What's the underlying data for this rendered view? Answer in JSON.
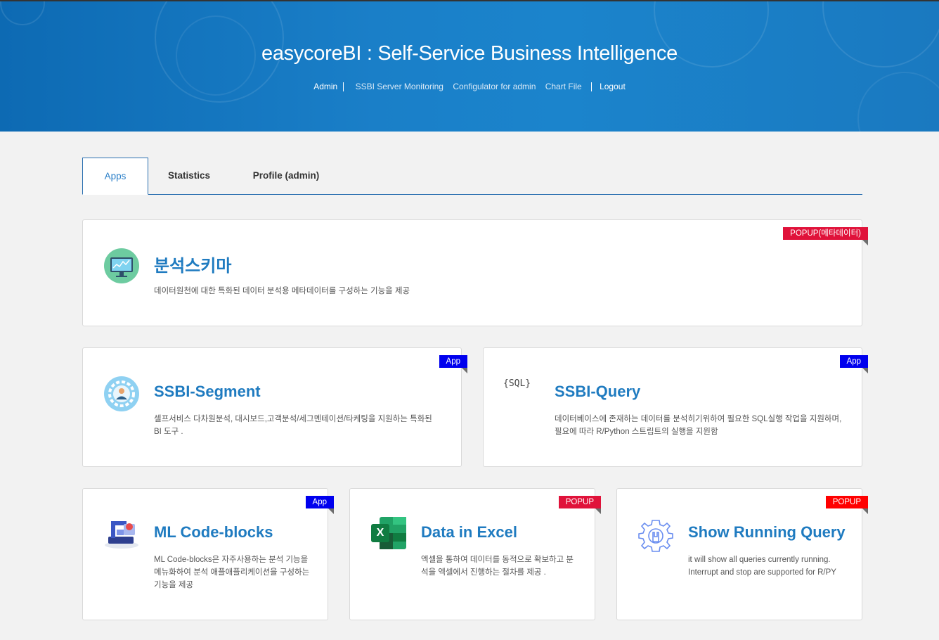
{
  "header": {
    "title": "easycoreBI : Self-Service Business Intelligence",
    "nav": {
      "admin": "Admin",
      "monitoring": "SSBI Server Monitoring",
      "configurator": "Configulator for admin",
      "chart_file": "Chart File",
      "logout": "Logout"
    }
  },
  "tabs": [
    "Apps",
    "Statistics",
    "Profile (admin)"
  ],
  "cards": [
    {
      "name": "분석스키마",
      "desc": "데이터원천에 대한 특화된 데이터 분석용 메타데이터를 구성하는 기능을 제공",
      "badge": "POPUP(메타데이터)",
      "icon": "monitor-chart-icon"
    },
    {
      "name": "SSBI-Segment",
      "desc": "셀프서비스 다차원분석, 대시보드,고객분석/세그멘테이션/타케팅을 지원하는 특화된 BI 도구 .",
      "badge": "App",
      "icon": "user-gear-icon"
    },
    {
      "name": "SSBI-Query",
      "desc": "데이터베이스에 존재하는 데이터를 분석히기위하여 필요한 SQL실행 작업을 지원하며, 필요에 따라 R/Python 스트립트의 실행을 지원함",
      "badge": "App",
      "icon": "sql-icon",
      "icon_text": "{SQL}"
    },
    {
      "name": "ML Code-blocks",
      "desc": "ML Code-blocks은 자주사용하는 분석 기능을 메뉴화하여 분석 애플애플리케이션을 구성하는 기능을 제공",
      "badge": "App",
      "icon": "robot-arm-icon"
    },
    {
      "name": "Data in Excel",
      "desc": "엑셀을 통하여 데이터를 동적으로 확보하고 분석을 엑셀에서 진행하는 절차를 제공 .",
      "badge": "POPUP",
      "icon": "excel-icon",
      "icon_text": "X"
    },
    {
      "name": "Show Running Query",
      "desc": "it will show all queries currently running. Interrupt and stop are supported for R/PY",
      "badge": "POPUP",
      "icon": "gear-wrench-icon"
    }
  ],
  "colors": {
    "accent": "#1f7bc0",
    "banner": "#1a7fc8",
    "popup": "#e0123a",
    "app": "#0000ee"
  }
}
